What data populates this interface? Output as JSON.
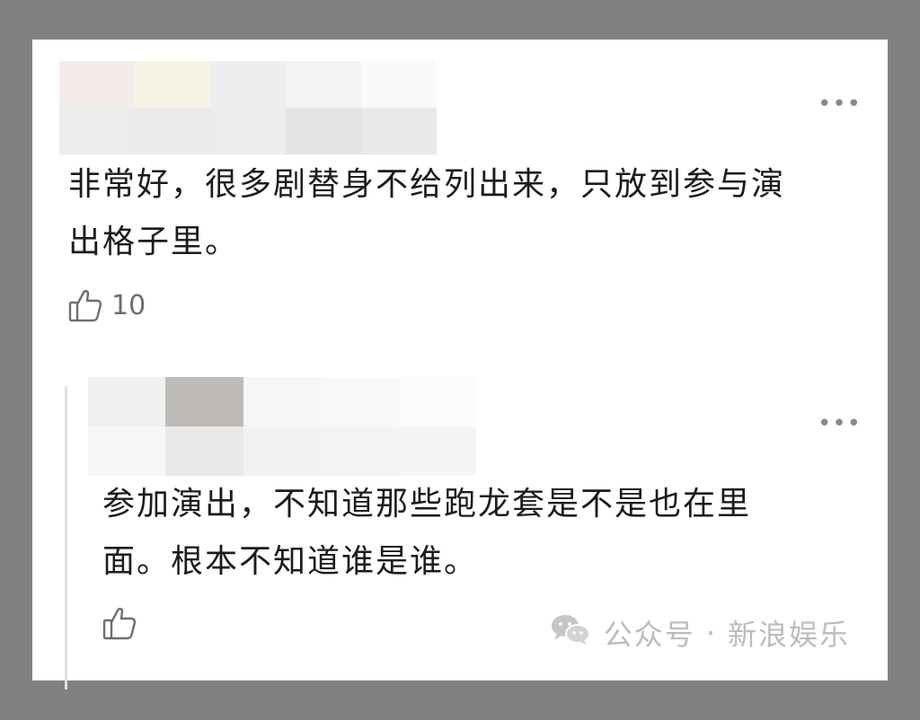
{
  "comments": [
    {
      "text_line1": "非常好，很多剧替身不给列出来，只放到参与演",
      "text_line2": "出格子里。",
      "likes": "10",
      "more_label": "•••"
    },
    {
      "text_line1": "参加演出，不知道那些跑龙套是不是也在里",
      "text_line2": "面。根本不知道谁是谁。",
      "more_label": "•••"
    }
  ],
  "icons": {
    "more": "more-dots-icon",
    "like": "thumbs-up-icon",
    "watermark": "wechat-icon"
  },
  "watermark": {
    "source": "公众号",
    "separator": "·",
    "account": "新浪娱乐"
  },
  "colors": {
    "background": "#818181",
    "card": "#ffffff",
    "text": "#1c1c1c",
    "muted": "#8a8a8a",
    "watermark": "#bcbcbc"
  }
}
